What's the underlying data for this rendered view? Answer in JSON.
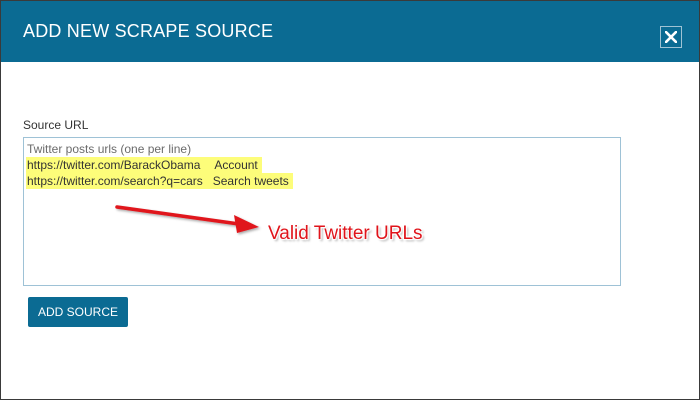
{
  "dialog": {
    "title": "ADD NEW SCRAPE SOURCE",
    "close_icon": "close-icon"
  },
  "form": {
    "source_url_label": "Source URL",
    "textarea": {
      "placeholder": "Twitter posts urls (one per line)",
      "lines": [
        {
          "url": "https://twitter.com/BarackObama",
          "note": "Account"
        },
        {
          "url": "https://twitter.com/search?q=cars",
          "note": "Search tweets"
        }
      ]
    },
    "add_source_label": "ADD SOURCE"
  },
  "annotation": {
    "text": "Valid Twitter URLs",
    "arrow_icon": "red-arrow-icon"
  },
  "colors": {
    "header": "#0b6b93",
    "button": "#0b6b93",
    "highlight": "#fdfd7a",
    "annotation": "#e0141b"
  }
}
